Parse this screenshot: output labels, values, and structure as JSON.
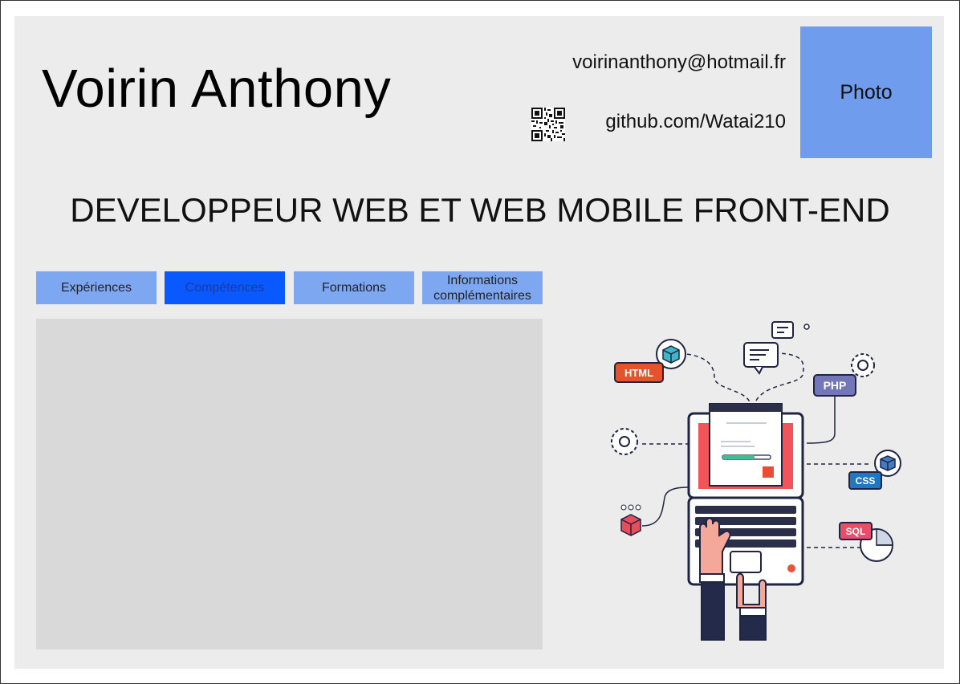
{
  "header": {
    "name": "Voirin Anthony",
    "email": "voirinanthony@hotmail.fr",
    "github": "github.com/Watai210",
    "photo_label": "Photo"
  },
  "title": "DEVELOPPEUR WEB ET WEB MOBILE FRONT-END",
  "tabs": [
    {
      "label": "Expériences",
      "active": false
    },
    {
      "label": "Compétences",
      "active": true
    },
    {
      "label": "Formations",
      "active": false
    },
    {
      "label": "Informations complémentaires",
      "active": false
    }
  ],
  "illustration": {
    "badges": {
      "html": "HTML",
      "php": "PHP",
      "css": "CSS",
      "sql": "SQL"
    }
  },
  "colors": {
    "card_bg": "#ececec",
    "tab_bg": "#7ea7f2",
    "tab_active_bg": "#0a59ff",
    "photo_bg": "#6f9ced",
    "panel_bg": "#d9d9d9"
  }
}
